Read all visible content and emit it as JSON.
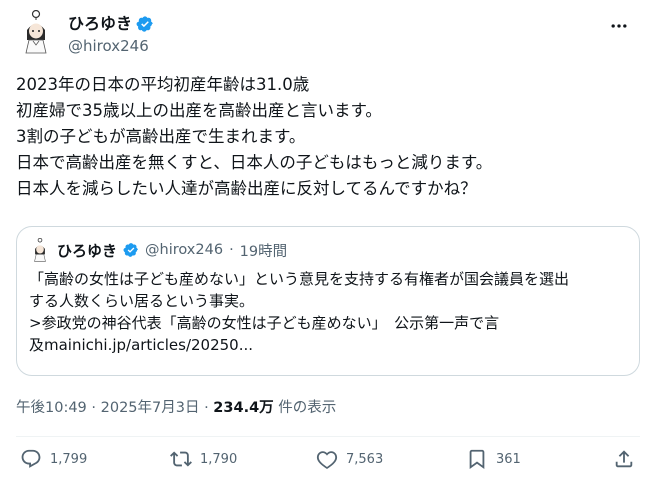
{
  "author": {
    "display_name": "ひろゆき",
    "handle": "@hirox246",
    "verified_icon": "verified-badge-icon"
  },
  "tweet": {
    "lines": [
      "2023年の日本の平均初産年齢は31.0歳",
      "初産婦で35歳以上の出産を高齢出産と言います。",
      "3割の子どもが高齢出産で生まれます。",
      "日本で高齢出産を無くすと、日本人の子どもはもっと減ります。",
      "日本人を減らしたい人達が高齢出産に反対してるんですかね？"
    ]
  },
  "quote": {
    "display_name": "ひろゆき",
    "handle": "@hirox246",
    "dot": "·",
    "time": "19時間",
    "lines": [
      "「高齢の女性は子ども産めない」という意見を支持する有権者が国会議員を選出",
      "する人数くらい居るという事実。",
      ">参政党の神谷代表「高齢の女性は子ども産めない」　公示第一声で言",
      "及mainichi.jp/articles/20250..."
    ]
  },
  "meta": {
    "time": "午後10:49 · 2025年7月3日 · ",
    "views": "234.4万",
    "views_label": " 件の表示"
  },
  "actions": {
    "reply": "1,799",
    "retweet": "1,790",
    "like": "7,563",
    "bookmark": "361"
  },
  "colors": {
    "text": "#0f1419",
    "secondary": "#536471",
    "verified": "#1d9bf0",
    "border": "#cfd9de"
  }
}
